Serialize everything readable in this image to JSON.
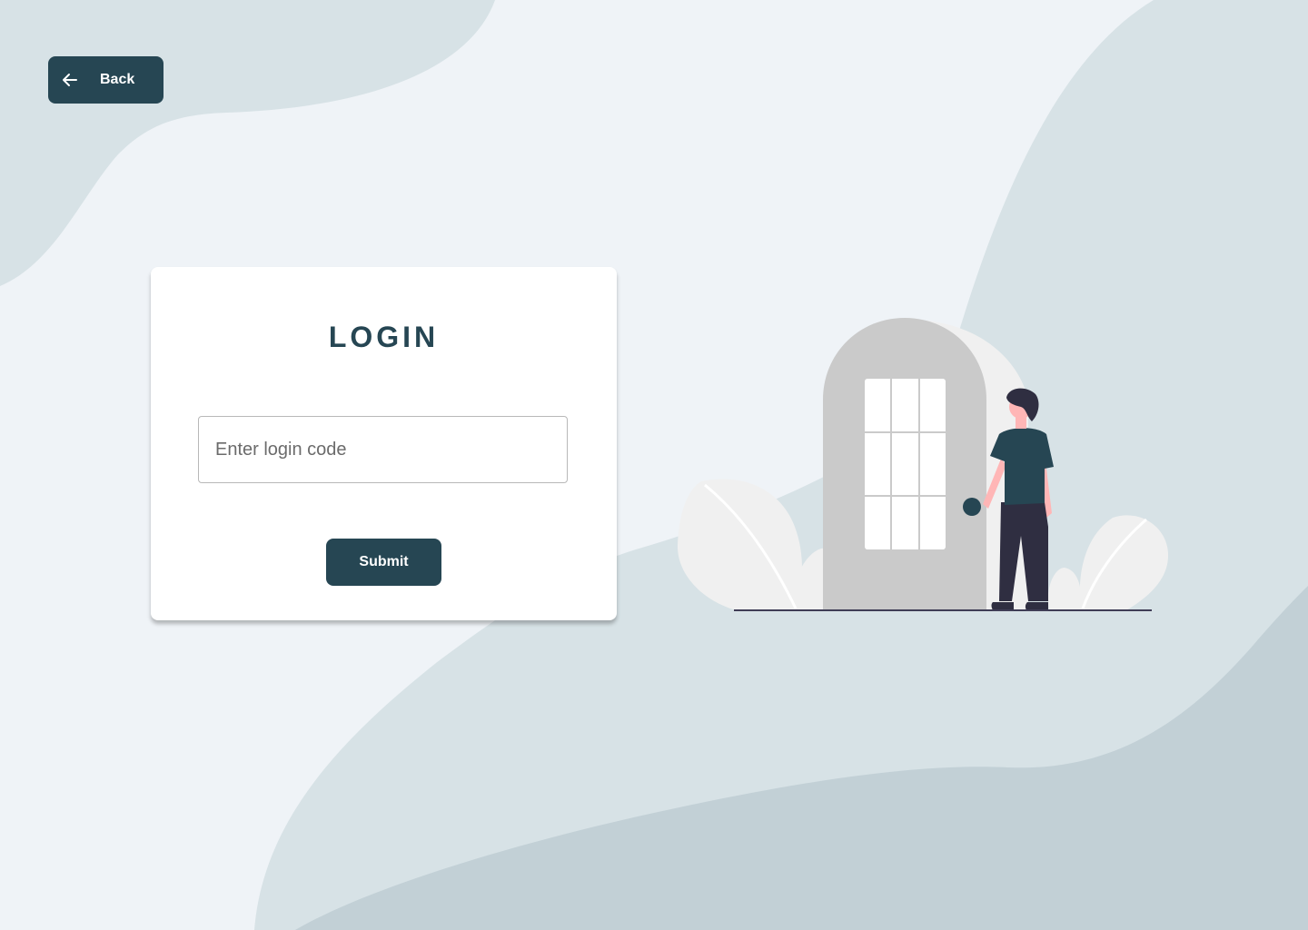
{
  "header": {
    "back_label": "Back",
    "back_icon": "arrow-left-icon"
  },
  "login": {
    "title": "LOGIN",
    "code_placeholder": "Enter login code",
    "code_value": "",
    "submit_label": "Submit"
  },
  "colors": {
    "primary": "#264653",
    "background": "#eff3f7",
    "blob_light": "#d7e2e6",
    "blob_dark": "#c2d0d6",
    "card": "#ffffff"
  },
  "illustration": {
    "icon": "person-at-door-illustration"
  }
}
